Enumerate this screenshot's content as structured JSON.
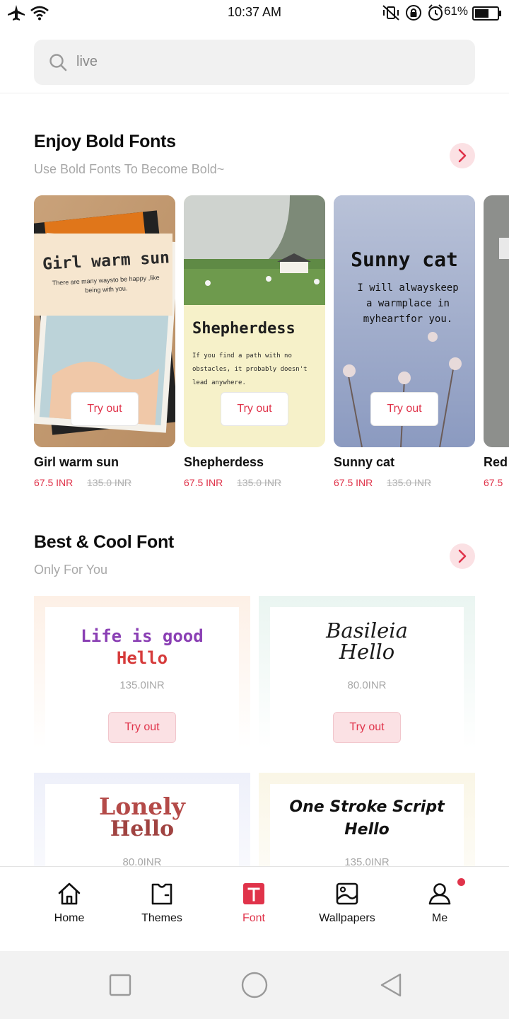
{
  "status_bar": {
    "time": "10:37 AM",
    "battery": "61%"
  },
  "search": {
    "placeholder": "live"
  },
  "section_bold": {
    "title": "Enjoy Bold Fonts",
    "subtitle": "Use Bold Fonts To Become Bold~",
    "cards": [
      {
        "name": "Girl warm sun",
        "price": "67.5 INR",
        "old_price": "135.0 INR",
        "try": "Try out",
        "art_title": "Girl warm sun",
        "art_text": "There are many waysto be happy ,like being with you."
      },
      {
        "name": "Shepherdess",
        "price": "67.5 INR",
        "old_price": "135.0 INR",
        "try": "Try out",
        "art_title": "Shepherdess",
        "art_text": "If you find a path with no obstacles, it probably doesn't lead anywhere."
      },
      {
        "name": "Sunny cat",
        "price": "67.5 INR",
        "old_price": "135.0 INR",
        "try": "Try out",
        "art_title": "Sunny cat",
        "art_text": "I will alwayskeep a warmplace in myheartfor you."
      },
      {
        "name": "Red s",
        "price": "67.5"
      }
    ]
  },
  "section_cool": {
    "title": "Best & Cool Font",
    "subtitle": "Only For You",
    "fonts": [
      {
        "line1": "Life is good",
        "line2": "Hello",
        "price": "135.0INR",
        "try": "Try out",
        "tint": "#fdf3ec"
      },
      {
        "line1": "Basileia",
        "line2": "Hello",
        "price": "80.0INR",
        "try": "Try out",
        "tint": "#eef7f4"
      },
      {
        "line1": "Lonely",
        "line2": "Hello",
        "price": "80.0INR",
        "tint": "#f2f4fb"
      },
      {
        "line1": "One Stroke Script",
        "line2": "Hello",
        "price": "135.0INR",
        "tint": "#fbf8ec"
      }
    ]
  },
  "bottom_nav": [
    {
      "label": "Home",
      "icon": "home-icon"
    },
    {
      "label": "Themes",
      "icon": "shirt-icon"
    },
    {
      "label": "Font",
      "icon": "font-icon",
      "active": true
    },
    {
      "label": "Wallpapers",
      "icon": "image-icon"
    },
    {
      "label": "Me",
      "icon": "person-icon",
      "badge": true
    }
  ],
  "colors": {
    "accent": "#e0334a",
    "accent_soft": "#fbe1e4"
  }
}
